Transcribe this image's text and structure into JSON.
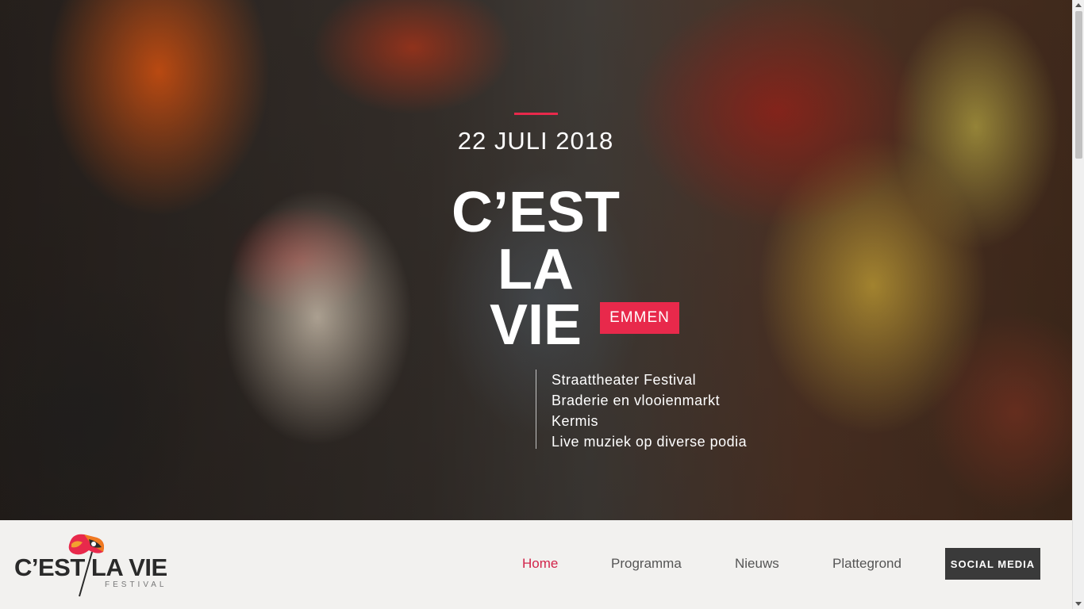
{
  "hero": {
    "date": "22 JULI 2018",
    "title_lines": [
      "C’EST",
      "LA",
      "VIE"
    ],
    "city": "EMMEN",
    "features": [
      "Straattheater Festival",
      "Braderie en vlooienmarkt",
      "Kermis",
      "Live muziek op diverse podia"
    ],
    "accent_color": "#e8294b"
  },
  "logo": {
    "text": "C’EST LA VIE",
    "subtitle": "FESTIVAL"
  },
  "nav": {
    "items": [
      {
        "label": "Home",
        "active": true
      },
      {
        "label": "Programma",
        "active": false
      },
      {
        "label": "Nieuws",
        "active": false
      },
      {
        "label": "Plattegrond",
        "active": false
      }
    ],
    "social_label": "SOCIAL MEDIA"
  },
  "colors": {
    "accent": "#e8294b",
    "nav_active": "#d2244a",
    "button_bg": "#3a3a3a",
    "navbar_bg": "#f2f1ef"
  }
}
